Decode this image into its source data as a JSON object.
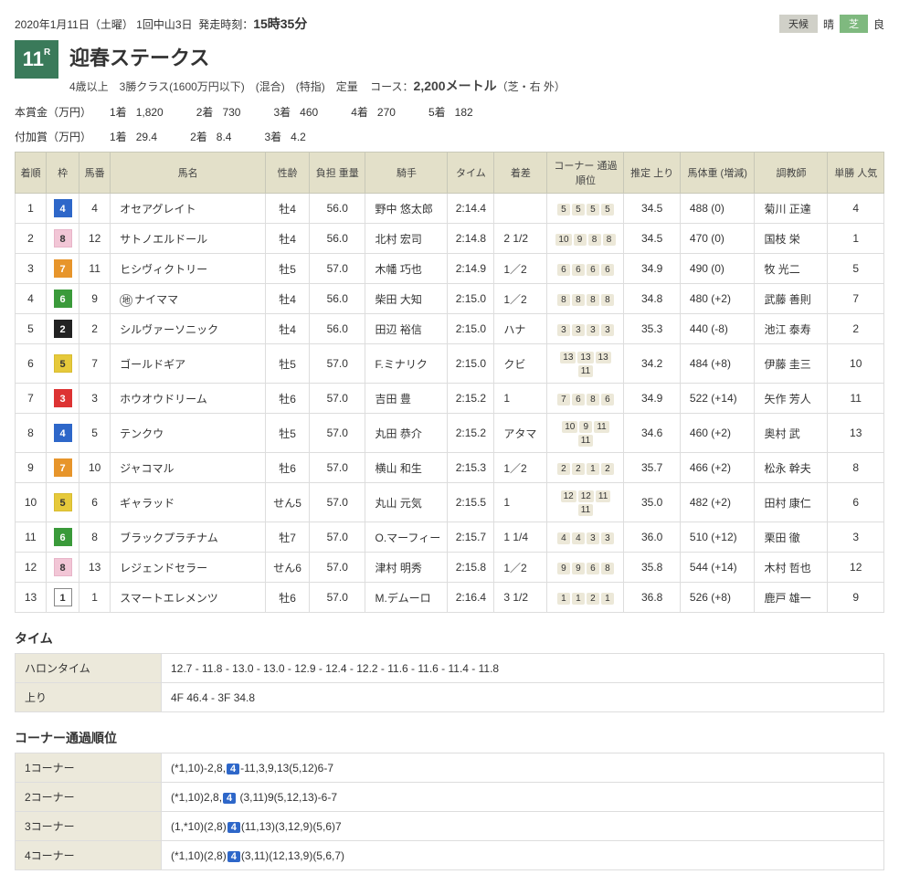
{
  "header": {
    "date_meet": "2020年1月11日（土曜） 1回中山3日",
    "starttime_label": "発走時刻：",
    "starttime": "15時35分",
    "weather_label": "天候",
    "weather_value": "晴",
    "turf_label": "芝",
    "turf_value": "良"
  },
  "race": {
    "number": "11",
    "r_suffix": "R",
    "name": "迎春ステークス",
    "condition_a": "4歳以上　3勝クラス(1600万円以下)　(混合)　(特指)　定量",
    "course_label": "コース：",
    "course_value": "2,200メートル",
    "course_tail": "（芝・右 外）"
  },
  "prize": {
    "main_label": "本賞金（万円）",
    "add_label": "付加賞（万円）",
    "main": {
      "p1l": "1着",
      "p1": "1,820",
      "p2l": "2着",
      "p2": "730",
      "p3l": "3着",
      "p3": "460",
      "p4l": "4着",
      "p4": "270",
      "p5l": "5着",
      "p5": "182"
    },
    "add": {
      "p1l": "1着",
      "p1": "29.4",
      "p2l": "2着",
      "p2": "8.4",
      "p3l": "3着",
      "p3": "4.2"
    }
  },
  "cols": {
    "pos": "着順",
    "waku": "枠",
    "num": "馬番",
    "horse": "馬名",
    "sex": "性齢",
    "wt": "負担\n重量",
    "jockey": "騎手",
    "time": "タイム",
    "diff": "着差",
    "corner": "コーナー\n通過順位",
    "agari": "推定\n上り",
    "bodywt": "馬体重\n(増減)",
    "trainer": "調教師",
    "pop": "単勝\n人気"
  },
  "rows": [
    {
      "pos": "1",
      "waku": "4",
      "wclass": "w4",
      "num": "4",
      "horse": "オセアグレイト",
      "sex": "牡4",
      "wt": "56.0",
      "jockey": "野中 悠太郎",
      "time": "2:14.4",
      "diff": "",
      "corner": [
        "5",
        "5",
        "5",
        "5"
      ],
      "agari": "34.5",
      "bodywt": "488 (0)",
      "trainer": "菊川 正達",
      "pop": "4"
    },
    {
      "pos": "2",
      "waku": "8",
      "wclass": "w8",
      "num": "12",
      "horse": "サトノエルドール",
      "sex": "牡4",
      "wt": "56.0",
      "jockey": "北村 宏司",
      "time": "2:14.8",
      "diff": "2 1/2",
      "corner": [
        "10",
        "9",
        "8",
        "8"
      ],
      "agari": "34.5",
      "bodywt": "470 (0)",
      "trainer": "国枝 栄",
      "pop": "1"
    },
    {
      "pos": "3",
      "waku": "7",
      "wclass": "w7",
      "num": "11",
      "horse": "ヒシヴィクトリー",
      "sex": "牡5",
      "wt": "57.0",
      "jockey": "木幡 巧也",
      "time": "2:14.9",
      "diff": "1／2",
      "corner": [
        "6",
        "6",
        "6",
        "6"
      ],
      "agari": "34.9",
      "bodywt": "490 (0)",
      "trainer": "牧 光二",
      "pop": "5"
    },
    {
      "pos": "4",
      "waku": "6",
      "wclass": "w6",
      "num": "9",
      "horse": "ナイママ",
      "jimoto": true,
      "sex": "牡4",
      "wt": "56.0",
      "jockey": "柴田 大知",
      "time": "2:15.0",
      "diff": "1／2",
      "corner": [
        "8",
        "8",
        "8",
        "8"
      ],
      "agari": "34.8",
      "bodywt": "480 (+2)",
      "trainer": "武藤 善則",
      "pop": "7"
    },
    {
      "pos": "5",
      "waku": "2",
      "wclass": "w2",
      "num": "2",
      "horse": "シルヴァーソニック",
      "sex": "牡4",
      "wt": "56.0",
      "jockey": "田辺 裕信",
      "time": "2:15.0",
      "diff": "ハナ",
      "corner": [
        "3",
        "3",
        "3",
        "3"
      ],
      "agari": "35.3",
      "bodywt": "440 (-8)",
      "trainer": "池江 泰寿",
      "pop": "2"
    },
    {
      "pos": "6",
      "waku": "5",
      "wclass": "w5",
      "num": "7",
      "horse": "ゴールドギア",
      "sex": "牡5",
      "wt": "57.0",
      "jockey": "F.ミナリク",
      "time": "2:15.0",
      "diff": "クビ",
      "corner": [
        "13",
        "13",
        "13",
        "11"
      ],
      "agari": "34.2",
      "bodywt": "484 (+8)",
      "trainer": "伊藤 圭三",
      "pop": "10"
    },
    {
      "pos": "7",
      "waku": "3",
      "wclass": "w3",
      "num": "3",
      "horse": "ホウオウドリーム",
      "sex": "牡6",
      "wt": "57.0",
      "jockey": "吉田 豊",
      "time": "2:15.2",
      "diff": "1",
      "corner": [
        "7",
        "6",
        "8",
        "6"
      ],
      "agari": "34.9",
      "bodywt": "522 (+14)",
      "trainer": "矢作 芳人",
      "pop": "11"
    },
    {
      "pos": "8",
      "waku": "4",
      "wclass": "w4",
      "num": "5",
      "horse": "テンクウ",
      "sex": "牡5",
      "wt": "57.0",
      "jockey": "丸田 恭介",
      "time": "2:15.2",
      "diff": "アタマ",
      "corner": [
        "10",
        "9",
        "11",
        "11"
      ],
      "agari": "34.6",
      "bodywt": "460 (+2)",
      "trainer": "奥村 武",
      "pop": "13"
    },
    {
      "pos": "9",
      "waku": "7",
      "wclass": "w7",
      "num": "10",
      "horse": "ジャコマル",
      "sex": "牡6",
      "wt": "57.0",
      "jockey": "横山 和生",
      "time": "2:15.3",
      "diff": "1／2",
      "corner": [
        "2",
        "2",
        "1",
        "2"
      ],
      "agari": "35.7",
      "bodywt": "466 (+2)",
      "trainer": "松永 幹夫",
      "pop": "8"
    },
    {
      "pos": "10",
      "waku": "5",
      "wclass": "w5",
      "num": "6",
      "horse": "ギャラッド",
      "sex": "せん5",
      "wt": "57.0",
      "jockey": "丸山 元気",
      "time": "2:15.5",
      "diff": "1",
      "corner": [
        "12",
        "12",
        "11",
        "11"
      ],
      "agari": "35.0",
      "bodywt": "482 (+2)",
      "trainer": "田村 康仁",
      "pop": "6"
    },
    {
      "pos": "11",
      "waku": "6",
      "wclass": "w6",
      "num": "8",
      "horse": "ブラックプラチナム",
      "sex": "牡7",
      "wt": "57.0",
      "jockey": "O.マーフィー",
      "time": "2:15.7",
      "diff": "1 1/4",
      "corner": [
        "4",
        "4",
        "3",
        "3"
      ],
      "agari": "36.0",
      "bodywt": "510 (+12)",
      "trainer": "栗田 徹",
      "pop": "3"
    },
    {
      "pos": "12",
      "waku": "8",
      "wclass": "w8",
      "num": "13",
      "horse": "レジェンドセラー",
      "sex": "せん6",
      "wt": "57.0",
      "jockey": "津村 明秀",
      "time": "2:15.8",
      "diff": "1／2",
      "corner": [
        "9",
        "9",
        "6",
        "8"
      ],
      "agari": "35.8",
      "bodywt": "544 (+14)",
      "trainer": "木村 哲也",
      "pop": "12"
    },
    {
      "pos": "13",
      "waku": "1",
      "wclass": "w1",
      "num": "1",
      "horse": "スマートエレメンツ",
      "sex": "牡6",
      "wt": "57.0",
      "jockey": "M.デムーロ",
      "time": "2:16.4",
      "diff": "3 1/2",
      "corner": [
        "1",
        "1",
        "2",
        "1"
      ],
      "agari": "36.8",
      "bodywt": "526 (+8)",
      "trainer": "鹿戸 雄一",
      "pop": "9"
    }
  ],
  "time_section": {
    "title": "タイム",
    "furlong_label": "ハロンタイム",
    "furlong_value": "12.7 - 11.8 - 13.0 - 13.0 - 12.9 - 12.4 - 12.2 - 11.6 - 11.6 - 11.4 - 11.8",
    "agari_label": "上り",
    "agari_value": "4F 46.4 - 3F 34.8"
  },
  "corner_section": {
    "title": "コーナー通過順位",
    "rows": [
      {
        "label": "1コーナー",
        "pre": "(*1,10)-2,8,",
        "winner": "4",
        "post": "-11,3,9,13(5,12)6-7"
      },
      {
        "label": "2コーナー",
        "pre": "(*1,10)2,8,",
        "winner": "4",
        "post": " (3,11)9(5,12,13)-6-7"
      },
      {
        "label": "3コーナー",
        "pre": "(1,*10)(2,8)",
        "winner": "4",
        "post": "(11,13)(3,12,9)(5,6)7"
      },
      {
        "label": "4コーナー",
        "pre": "(*1,10)(2,8)",
        "winner": "4",
        "post": "(3,11)(12,13,9)(5,6,7)"
      }
    ]
  },
  "chart_data": {
    "type": "table",
    "title": "迎春ステークス レース結果",
    "columns": [
      "着順",
      "枠",
      "馬番",
      "馬名",
      "性齢",
      "負担重量",
      "騎手",
      "タイム",
      "着差",
      "コーナー通過順位",
      "推定上り",
      "馬体重(増減)",
      "調教師",
      "単勝人気"
    ]
  }
}
